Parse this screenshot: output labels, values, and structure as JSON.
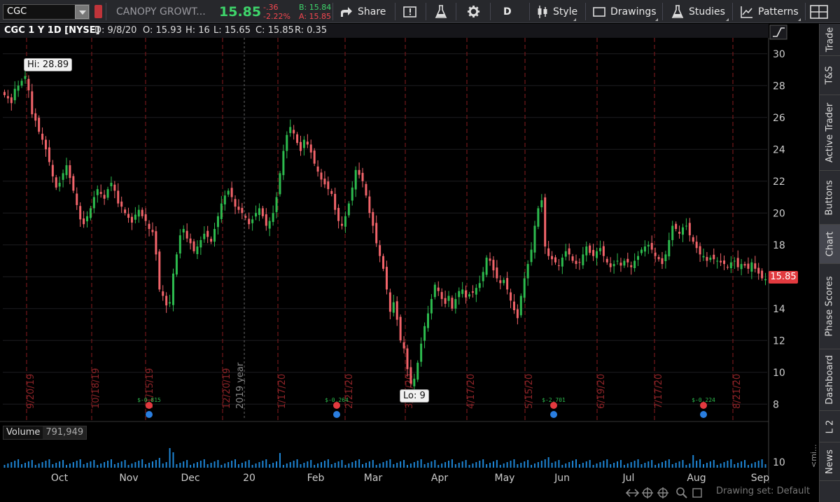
{
  "toolbar": {
    "symbol": "CGC",
    "company": "CANOPY GROWT...",
    "last": "15.85",
    "change": "-.36",
    "change_pct": "-2.22%",
    "bid": "B: 15.84",
    "ask": "A: 15.85",
    "share": "Share",
    "interval": "D",
    "style": "Style",
    "drawings": "Drawings",
    "studies": "Studies",
    "patterns": "Patterns"
  },
  "info": {
    "title": "CGC 1 Y 1D [NYSE]",
    "date": "D: 9/8/20",
    "open": "O: 15.93",
    "high": "H: 16",
    "low": "L: 15.65",
    "close": "C: 15.85",
    "range": "R: 0.35"
  },
  "annotations": {
    "hi": "Hi: 28.89",
    "lo": "Lo: 9",
    "price_label": "15.85",
    "year_marker": "2019 year"
  },
  "volume": {
    "label": "Volume",
    "value": "791,949",
    "axis_label": "10",
    "scale": "<mi..."
  },
  "sidebar": [
    "Trade",
    "T&S",
    "Active Trader",
    "Buttons",
    "Chart",
    "Phase Scores",
    "Dashboard",
    "L 2",
    "News"
  ],
  "bottom": {
    "drawing_set": "Drawing set: Default"
  },
  "colors": {
    "up": "#2dbb4e",
    "down": "#f2646a",
    "accent": "#3ed46a",
    "red": "#e23a3f"
  },
  "chart_data": {
    "type": "candlestick",
    "title": "CGC 1 Y 1D [NYSE]",
    "ylim": [
      7,
      31
    ],
    "y_ticks": [
      8,
      10,
      12,
      14,
      16,
      18,
      20,
      22,
      24,
      26,
      28,
      30
    ],
    "x_ticks": [
      "Oct",
      "Nov",
      "Dec",
      "20",
      "Feb",
      "Mar",
      "Apr",
      "May",
      "Jun",
      "Jul",
      "Aug",
      "Sep"
    ],
    "event_lines": [
      "9/20/19",
      "10/18/19",
      "11/15/19",
      "12/20/19",
      "1/17/20",
      "2/21/20",
      "3/20/20",
      "4/17/20",
      "5/15/20",
      "6/19/20",
      "7/17/20",
      "8/21/20"
    ],
    "dividend_labels": [
      "$-0.815",
      "$-0.264",
      "$-2.701",
      "$-0.224"
    ],
    "high": 28.89,
    "low": 9,
    "close": [
      27.4,
      27.2,
      26.9,
      27.8,
      28.0,
      28.3,
      28.6,
      27.7,
      26.2,
      25.8,
      25.1,
      24.6,
      24.0,
      23.2,
      22.3,
      21.6,
      21.9,
      22.5,
      23.0,
      22.2,
      21.4,
      20.5,
      19.6,
      19.3,
      19.8,
      20.3,
      21.0,
      21.5,
      21.2,
      20.9,
      21.5,
      21.9,
      21.4,
      20.6,
      20.4,
      20.0,
      19.7,
      19.4,
      19.9,
      20.2,
      19.8,
      19.5,
      19.0,
      18.8,
      17.4,
      15.2,
      14.8,
      14.2,
      14.4,
      16.2,
      17.4,
      18.6,
      19.0,
      18.4,
      18.1,
      17.6,
      17.9,
      18.3,
      18.7,
      18.5,
      18.2,
      19.0,
      19.8,
      20.6,
      21.1,
      21.4,
      21.0,
      20.4,
      20.2,
      20.0,
      19.7,
      19.3,
      19.6,
      20.0,
      20.3,
      19.8,
      19.2,
      19.5,
      20.0,
      21.0,
      22.5,
      23.9,
      24.9,
      25.4,
      25.0,
      24.4,
      23.9,
      24.6,
      24.3,
      23.8,
      23.1,
      22.6,
      22.1,
      21.8,
      21.5,
      21.2,
      20.2,
      19.5,
      19.2,
      19.8,
      20.6,
      21.6,
      22.7,
      22.4,
      22.0,
      21.1,
      20.0,
      19.2,
      18.1,
      17.3,
      16.5,
      15.2,
      13.8,
      14.4,
      13.3,
      12.0,
      11.5,
      10.2,
      9.3,
      9.6,
      10.6,
      11.8,
      12.9,
      13.7,
      14.6,
      15.5,
      15.1,
      14.6,
      14.3,
      14.8,
      14.0,
      14.6,
      15.1,
      15.2,
      14.7,
      14.9,
      15.0,
      15.3,
      15.6,
      16.3,
      17.2,
      17.0,
      16.4,
      15.9,
      15.6,
      15.8,
      15.2,
      14.5,
      13.9,
      13.4,
      14.8,
      15.9,
      16.8,
      17.7,
      19.2,
      20.3,
      20.8,
      17.9,
      17.3,
      17.1,
      16.9,
      16.7,
      17.2,
      17.6,
      17.4,
      17.0,
      16.8,
      16.9,
      17.4,
      17.9,
      17.5,
      17.3,
      17.6,
      17.8,
      17.3,
      16.9,
      16.6,
      16.8,
      17.0,
      16.7,
      17.0,
      16.9,
      16.6,
      17.0,
      17.3,
      17.7,
      17.9,
      18.0,
      17.7,
      17.3,
      17.1,
      16.8,
      17.4,
      18.3,
      19.2,
      19.0,
      18.7,
      19.1,
      19.2,
      18.6,
      18.2,
      17.8,
      17.4,
      17.3,
      17.0,
      17.2,
      17.1,
      17.0,
      16.9,
      16.8,
      16.6,
      16.9,
      17.0,
      16.6,
      16.8,
      16.7,
      16.5,
      16.9,
      16.5,
      16.2,
      15.9,
      15.85
    ]
  }
}
